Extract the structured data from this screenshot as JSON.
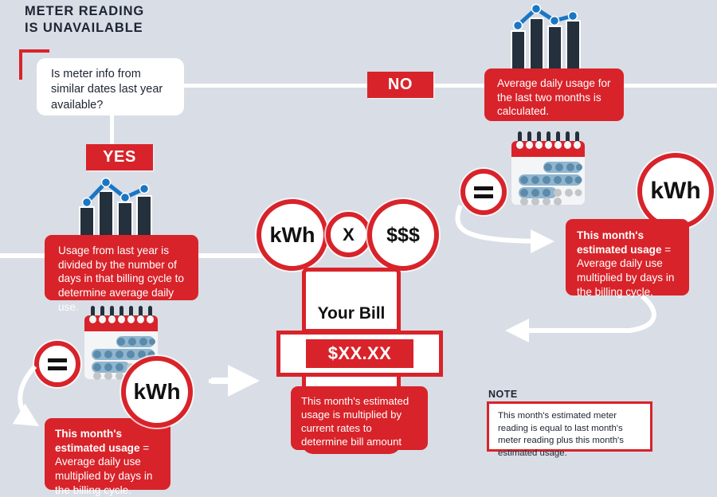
{
  "title": {
    "line1": "METER READING",
    "line2": "IS UNAVAILABLE"
  },
  "question": {
    "text": "Is meter info from similar dates last year available?"
  },
  "branches": {
    "yes_label": "YES",
    "no_label": "NO"
  },
  "boxes": {
    "average_daily": "Average daily usage for the last two months is calculated.",
    "last_year_usage": "Usage from last year is divided by the number of days in that billing cycle to determine average daily use.",
    "estimated_right_bold": "This month's estimated usage",
    "estimated_right_rest": " = Average daily use multiplied by days in the billing cycle.",
    "estimated_left_bold": "This month's estimated usage",
    "estimated_left_rest": " = Average daily use multiplied by days in the billing cycle.",
    "bill_note": "This month's estimated usage is multiplied by current rates to determine bill amount"
  },
  "formula": {
    "kwh": "kWh",
    "times": "X",
    "dollars": "$$$"
  },
  "bill": {
    "heading": "Your Bill",
    "amount": "$XX.XX"
  },
  "circles": {
    "equals": "=",
    "kwh": "kWh"
  },
  "note": {
    "label": "NOTE",
    "text": "This month's estimated meter reading is equal to last month's meter reading plus this month's estimated usage."
  },
  "colors": {
    "background": "#d9dde5",
    "red": "#d8232a",
    "navy": "#24303c",
    "blue_line": "#1a76c4",
    "calendar_blue": "#8fb5cf",
    "white": "#ffffff"
  },
  "chart_data": [
    {
      "type": "bar",
      "name": "top-right-usage-chart",
      "categories": [
        "1",
        "2",
        "3",
        "4"
      ],
      "values": [
        62,
        88,
        74,
        84
      ],
      "series": [
        {
          "name": "bars",
          "values": [
            62,
            88,
            74,
            84
          ]
        },
        {
          "name": "trend-line",
          "values": [
            70,
            100,
            84,
            92
          ]
        }
      ],
      "title": "",
      "xlabel": "",
      "ylabel": "",
      "ylim": [
        0,
        100
      ],
      "grid": false,
      "legend": false
    },
    {
      "type": "bar",
      "name": "left-usage-chart",
      "categories": [
        "1",
        "2",
        "3",
        "4"
      ],
      "values": [
        60,
        90,
        76,
        86
      ],
      "series": [
        {
          "name": "bars",
          "values": [
            60,
            90,
            76,
            86
          ]
        },
        {
          "name": "trend-line",
          "values": [
            68,
            100,
            82,
            94
          ]
        }
      ],
      "title": "",
      "xlabel": "",
      "ylabel": "",
      "ylim": [
        0,
        100
      ],
      "grid": false,
      "legend": false
    }
  ],
  "icons": {
    "calendar": "calendar-icon",
    "bar_chart": "bar-chart-icon",
    "equals": "equals-icon",
    "arrow": "arrow-icon",
    "corner_bracket": "corner-bracket-icon"
  }
}
